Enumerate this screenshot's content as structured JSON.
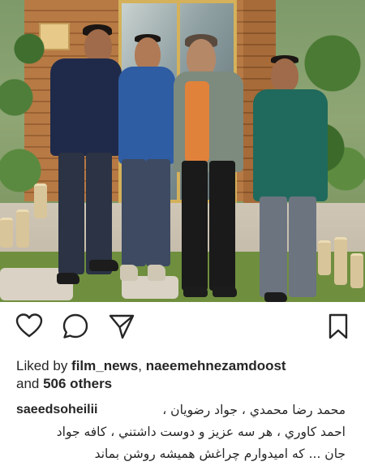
{
  "post": {
    "liked_by_prefix": "Liked by ",
    "liked_user_1": "film_news",
    "separator": ", ",
    "liked_user_2": "naeemehnezamdoost",
    "and_text": "and ",
    "others_count": "506 others",
    "caption_user": "saeedsoheilii",
    "caption_lines": [
      "محمد رضا محمدي ، جواد رضويان ،",
      "احمد کاوري ، هر سه عزيز و دوست داشتني ، کافه جواد",
      "جان ... که اميدوارم چراغش هميشه روشن بماند"
    ]
  },
  "icons": {
    "like": "heart-icon",
    "comment": "speech-bubble-icon",
    "share": "paper-plane-icon",
    "save": "bookmark-icon"
  },
  "colors": {
    "text": "#262626",
    "background": "#ffffff"
  }
}
